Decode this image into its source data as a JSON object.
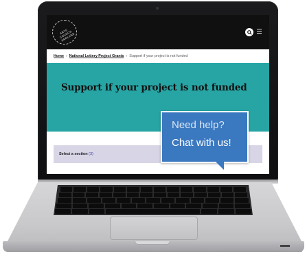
{
  "site": {
    "logo_text": "ARTS COUNCIL ENGLAND"
  },
  "breadcrumb": {
    "items": [
      {
        "label": "Home"
      },
      {
        "label": "National Lottery Project Grants"
      },
      {
        "label": "Support if your project is not funded"
      }
    ],
    "separator": "›"
  },
  "hero": {
    "title": "Support if your project is not funded",
    "color": "#27a5a5"
  },
  "section_select": {
    "label": "Select a section",
    "count": "(3)"
  },
  "chat": {
    "help_text": "Need help?",
    "cta_text": "Chat with us!",
    "color": "#3a78c0"
  },
  "icons": {
    "search": "search-icon",
    "menu": "hamburger-menu-icon"
  }
}
